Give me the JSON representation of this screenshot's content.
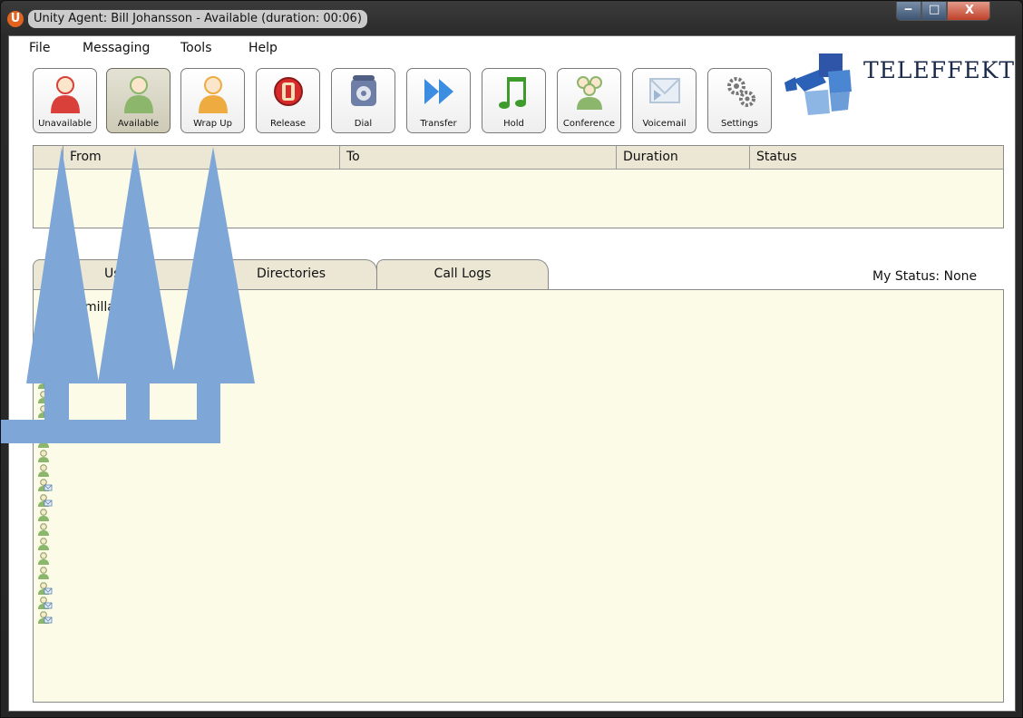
{
  "titlebar": {
    "app_icon_letter": "U",
    "title": "Unity Agent: Bill Johansson - Available (duration: 00:06)",
    "minimize": "‒",
    "maximize": "□",
    "close": "X"
  },
  "menu": [
    "File",
    "Messaging",
    "Tools",
    "Help"
  ],
  "toolbar": [
    {
      "label": "Unavailable",
      "icon": "user-red-icon",
      "color": "#d9403a"
    },
    {
      "label": "Available",
      "icon": "user-green-icon",
      "color": "#8bb66b",
      "active": true
    },
    {
      "label": "Wrap Up",
      "icon": "user-orange-icon",
      "color": "#eeab3f"
    },
    {
      "label": "Release",
      "icon": "release-icon",
      "color": "#d82a2a"
    },
    {
      "label": "Dial",
      "icon": "phone-icon",
      "color": "#6d7fa6"
    },
    {
      "label": "Transfer",
      "icon": "forward-arrows-icon",
      "color": "#3a8de0"
    },
    {
      "label": "Hold",
      "icon": "music-note-icon",
      "color": "#3f9c2c"
    },
    {
      "label": "Conference",
      "icon": "conference-icon",
      "color": "#8bb66b"
    },
    {
      "label": "Voicemail",
      "icon": "envelope-icon",
      "color": "#b5c6d8"
    },
    {
      "label": "Settings",
      "icon": "gears-icon",
      "color": "#777777"
    }
  ],
  "brand": {
    "name": "TELEFFEKT",
    "logo_icon": "puzzle-logo-icon"
  },
  "calls_table": {
    "columns": [
      "From",
      "To",
      "Duration",
      "Status"
    ],
    "rows": []
  },
  "tabs": [
    "Users",
    "Directories",
    "Call Logs"
  ],
  "visible_tab_text": {
    "users": "User"
  },
  "my_status": "My Status: None",
  "user_list": {
    "visible_name_fragment": "milla",
    "entry_icons": [
      "user-voicemail-icon",
      "user-green-icon"
    ]
  },
  "colors": {
    "accent": "#7ea6d6",
    "panel_bg": "#fbfbe8",
    "header_bg": "#ebe7d4"
  }
}
